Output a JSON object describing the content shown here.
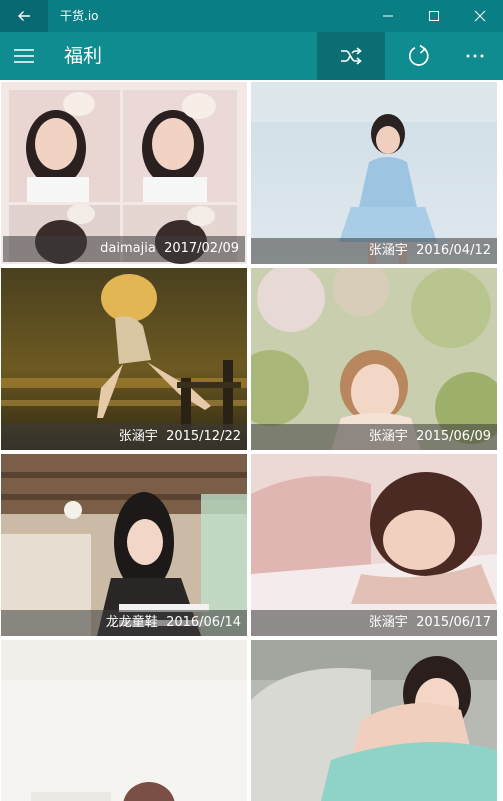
{
  "window": {
    "title": "干货.io"
  },
  "appbar": {
    "title": "福利"
  },
  "icons": {
    "back": "back-arrow-icon",
    "minimize": "minimize-icon",
    "maximize": "maximize-icon",
    "close": "close-icon",
    "menu": "hamburger-menu-icon",
    "shuffle": "shuffle-icon",
    "refresh": "refresh-icon",
    "more": "more-options-icon"
  },
  "colors": {
    "titlebar": "#0a7e85",
    "appbar": "#0f8c8f",
    "accent": "#0b6e72"
  },
  "photos": [
    {
      "author": "daimajia",
      "date": "2017/02/09"
    },
    {
      "author": "张涵宇",
      "date": "2016/04/12"
    },
    {
      "author": "张涵宇",
      "date": "2015/12/22"
    },
    {
      "author": "张涵宇",
      "date": "2015/06/09"
    },
    {
      "author": "龙龙童鞋",
      "date": "2016/06/14"
    },
    {
      "author": "张涵宇",
      "date": "2015/06/17"
    },
    {
      "author": "",
      "date": ""
    },
    {
      "author": "",
      "date": ""
    }
  ]
}
